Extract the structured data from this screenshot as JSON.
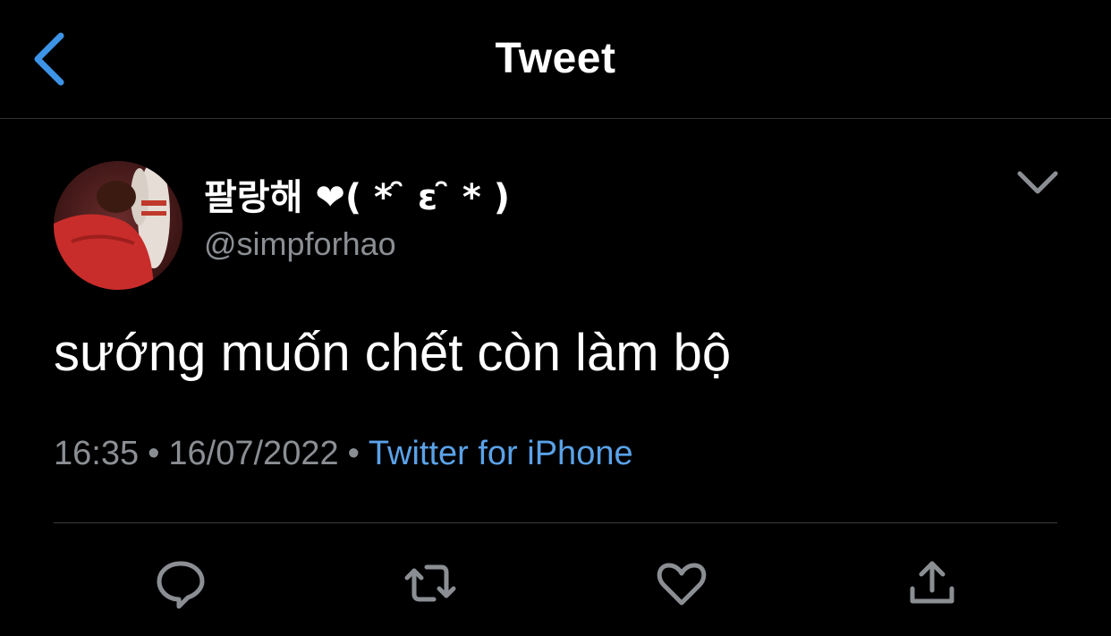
{
  "header": {
    "title": "Tweet",
    "back_icon": "chevron-left-icon"
  },
  "tweet": {
    "display_name": "팔랑해 ♥( ⁎ᵒ̴̶̷̤̀ωᵒ̴̶̷̤́ ⁎ )",
    "display_name_visible": "팔랑해 ❤( * ̑ ɛ ̑ * )",
    "handle": "@simpforhao",
    "text": "sướng muốn chết còn làm bộ",
    "time": "16:35",
    "date": "16/07/2022",
    "separator": "•",
    "source": "Twitter for iPhone",
    "more_icon": "chevron-down-icon"
  },
  "actions": {
    "reply_icon": "reply-icon",
    "retweet_icon": "retweet-icon",
    "like_icon": "heart-icon",
    "share_icon": "share-icon"
  },
  "colors": {
    "background": "#000000",
    "text": "#ffffff",
    "muted": "#8b8f94",
    "accent": "#5aa2e8",
    "divider": "#2f3336"
  }
}
